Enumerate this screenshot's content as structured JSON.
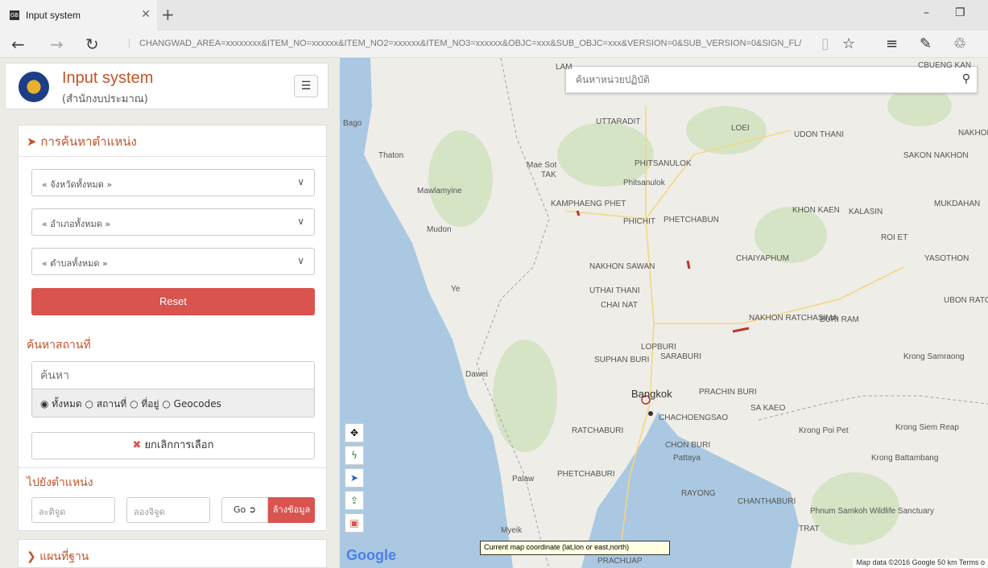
{
  "browser": {
    "tab_title": "Input system",
    "tab_favicon": "GB",
    "url": "CHANGWAD_AREA=xxxxxxxx&ITEM_NO=xxxxxx&ITEM_NO2=xxxxxx&ITEM_NO3=xxxxxx&OBJC=xxx&SUB_OBJC=xxx&VERSION=0&SUB_VERSION=0&SIGN_FL/"
  },
  "header": {
    "title": "Input system",
    "subtitle": "(สำนักงบประมาณ)"
  },
  "locate": {
    "title": "การค้นหาตำแหน่ง",
    "province": "« จังหวัดทั้งหมด »",
    "district": "« อำเภอทั้งหมด »",
    "subdistrict": "« ตำบลทั้งหมด »",
    "reset": "Reset"
  },
  "place_search": {
    "title": "ค้นหาสถานที่",
    "placeholder": "ค้นหา",
    "opt_all": "ทั้งหมด",
    "opt_place": "สถานที่",
    "opt_address": "ที่อยู่",
    "opt_geocodes": "Geocodes"
  },
  "cancel_selection": "ยกเลิกการเลือก",
  "goto": {
    "title": "ไปยังตำแหน่ง",
    "lat_placeholder": "ละติจูด",
    "lon_placeholder": "ลองจิจูด",
    "go": "Go",
    "clear": "ล้างข้อมูล"
  },
  "base_map": {
    "title": "แผนที่ฐาน"
  },
  "map": {
    "search_placeholder": "ค้นหาหน่วยปฏิบัติ",
    "coord_tip": "Current map coordinate (lat,lon or east,north)",
    "footer": "Map data ©2016 Google   50 km       Terms o",
    "google": "Google",
    "places": {
      "uttaradit": "UTTARADIT",
      "loei": "LOEI",
      "udon": "UDON THANI",
      "nakhon_phanom": "NAKHON PHANOM",
      "sakon": "SAKON NAKHON",
      "phitsanulok": "PHITSANULOK",
      "phitsanulok_town": "Phitsanulok",
      "tak": "TAK",
      "mae_sot": "Mae Sot",
      "kamphaeng": "KAMPHAENG PHET",
      "phichit": "PHICHIT",
      "phetchabun": "PHETCHABUN",
      "khon_kaen": "KHON KAEN",
      "kalasin": "KALASIN",
      "mukdahan": "MUKDAHAN",
      "roi_et": "ROI ET",
      "yasothon": "YASOTHON",
      "chaiyaphum": "CHAIYAPHUM",
      "nakhon_sawan": "NAKHON SAWAN",
      "uthai": "UTHAI THANI",
      "chai_nat": "CHAI NAT",
      "ratchasima": "NAKHON RATCHASIMA",
      "buri_ram": "BURI RAM",
      "ubon": "UBON RATCHATH",
      "lopburi": "LOPBURI",
      "saraburi": "SARABURI",
      "suphan": "SUPHAN BURI",
      "bangkok": "Bangkok",
      "prachin": "PRACHIN BURI",
      "chachoengsao": "CHACHOENGSAO",
      "sa_kaeo": "SA KAEO",
      "ratchaburi": "RATCHABURI",
      "chon_buri": "CHON BURI",
      "pattaya": "Pattaya",
      "rayong": "RAYONG",
      "chanthaburi": "CHANTHABURI",
      "trat": "TRAT",
      "phetchaburi": "PHETCHABURI",
      "prachuap": "PRACHUAP",
      "mawlamyine": "Mawlamyine",
      "dawei": "Dawei",
      "thaton": "Thaton",
      "bago": "Bago",
      "mudon": "Mudon",
      "ye": "Ye",
      "krong_poi": "Krong Poi Pet",
      "siem_reap": "Krong Siem Reap",
      "battambang": "Krong Battambang",
      "samrong": "Krong Samraong",
      "phnum": "Phnum Samkoh Wildlife Sanctuary",
      "myeik": "Myeik",
      "palaw": "Palaw",
      "lam": "LAM",
      "buengkan": "CBUENG KAN"
    }
  },
  "colors": {
    "accent": "#c4532a",
    "danger": "#d9534f",
    "sea": "#aac8e2",
    "land": "#eeede8",
    "forest": "#d6e4c6"
  }
}
